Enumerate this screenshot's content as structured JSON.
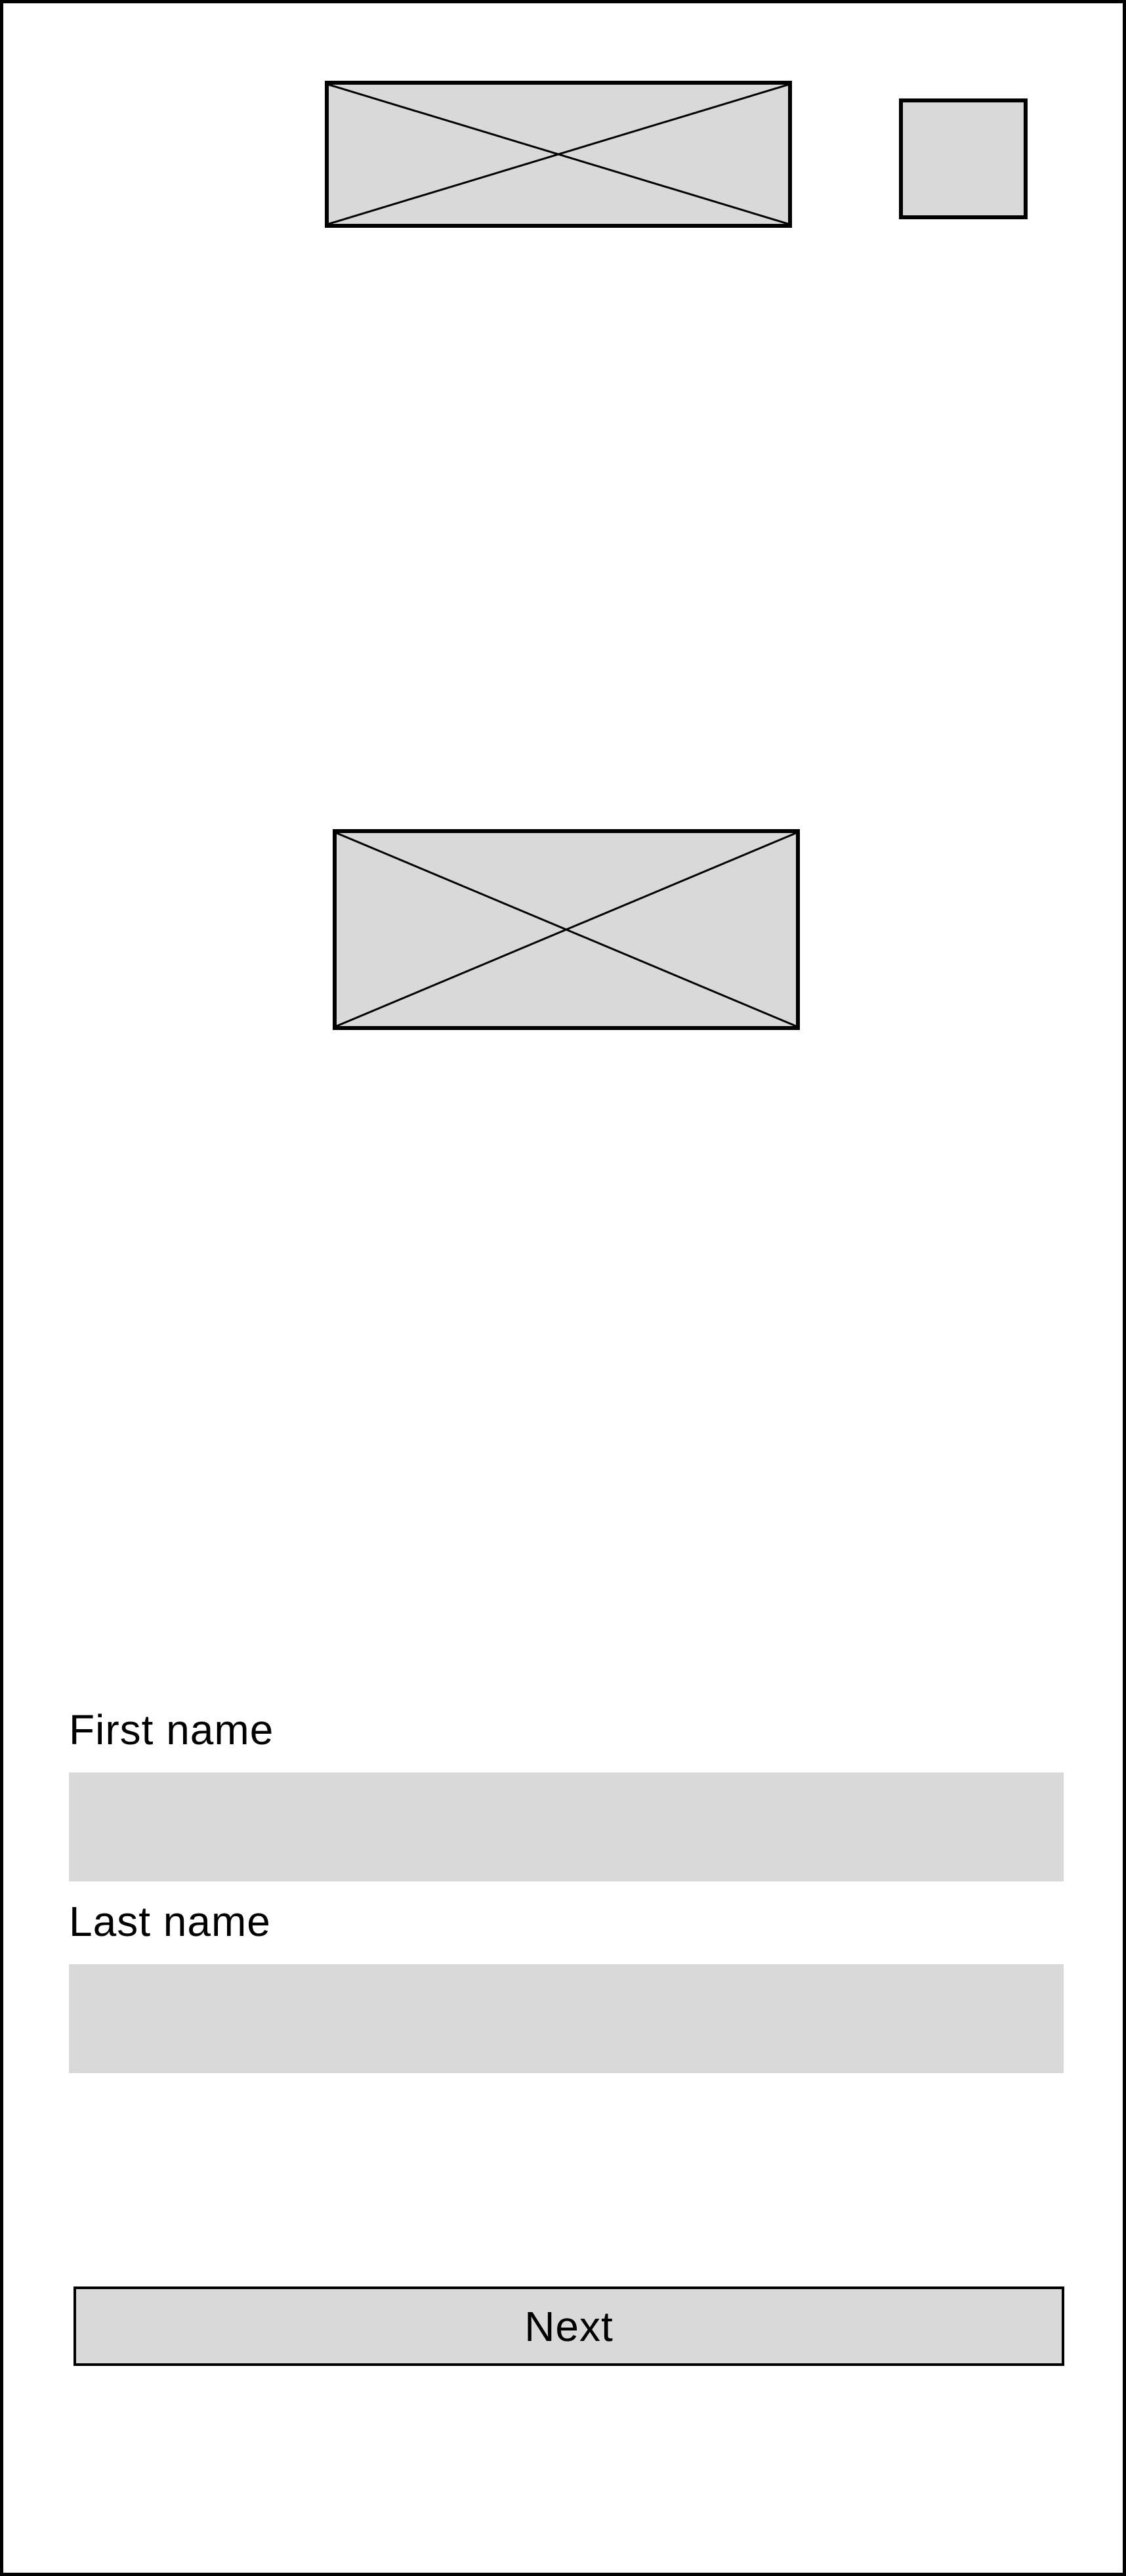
{
  "form": {
    "first_name": {
      "label": "First name",
      "value": "",
      "placeholder": ""
    },
    "last_name": {
      "label": "Last name",
      "value": "",
      "placeholder": ""
    }
  },
  "actions": {
    "next_label": "Next"
  },
  "colors": {
    "placeholder_fill": "#d9d9d9",
    "outline": "#000000",
    "background": "#ffffff"
  },
  "icons": {
    "header_image": "image-placeholder-icon",
    "header_square": "square-placeholder-icon",
    "main_image": "image-placeholder-icon"
  }
}
